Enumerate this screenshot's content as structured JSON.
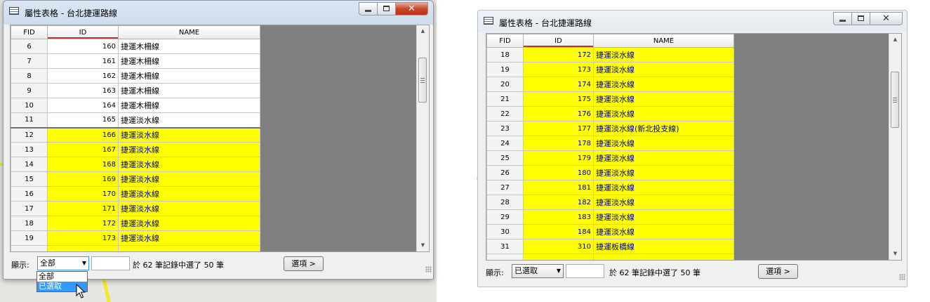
{
  "left_window": {
    "title": "屬性表格 - 台北捷運路線",
    "columns": [
      "FID",
      "ID",
      "NAME"
    ],
    "rows": [
      {
        "fid": "6",
        "id": "160",
        "name": "捷運木柵線",
        "selected": false
      },
      {
        "fid": "7",
        "id": "161",
        "name": "捷運木柵線",
        "selected": false
      },
      {
        "fid": "8",
        "id": "162",
        "name": "捷運木柵線",
        "selected": false
      },
      {
        "fid": "9",
        "id": "163",
        "name": "捷運木柵線",
        "selected": false
      },
      {
        "fid": "10",
        "id": "164",
        "name": "捷運木柵線",
        "selected": false
      },
      {
        "fid": "11",
        "id": "165",
        "name": "捷運淡水線",
        "selected": false
      },
      {
        "fid": "12",
        "id": "166",
        "name": "捷運淡水線",
        "selected": true
      },
      {
        "fid": "13",
        "id": "167",
        "name": "捷運淡水線",
        "selected": true
      },
      {
        "fid": "14",
        "id": "168",
        "name": "捷運淡水線",
        "selected": true
      },
      {
        "fid": "15",
        "id": "169",
        "name": "捷運淡水線",
        "selected": true
      },
      {
        "fid": "16",
        "id": "170",
        "name": "捷運淡水線",
        "selected": true
      },
      {
        "fid": "17",
        "id": "171",
        "name": "捷運淡水線",
        "selected": true
      },
      {
        "fid": "18",
        "id": "172",
        "name": "捷運淡水線",
        "selected": true
      },
      {
        "fid": "19",
        "id": "173",
        "name": "捷運淡水線",
        "selected": true
      }
    ],
    "footer": {
      "show_label": "顯示:",
      "show_value": "全部",
      "record_text": "於 62 筆記錄中選了 50 筆",
      "options_button": "選項 >"
    },
    "dropdown_options": [
      "全部",
      "已選取"
    ],
    "highlighted_option": "已選取"
  },
  "right_window": {
    "title": "屬性表格 - 台北捷運路線",
    "columns": [
      "FID",
      "ID",
      "NAME"
    ],
    "rows": [
      {
        "fid": "18",
        "id": "172",
        "name": "捷運淡水線",
        "selected": true
      },
      {
        "fid": "19",
        "id": "173",
        "name": "捷運淡水線",
        "selected": true
      },
      {
        "fid": "20",
        "id": "174",
        "name": "捷運淡水線",
        "selected": true
      },
      {
        "fid": "21",
        "id": "175",
        "name": "捷運淡水線",
        "selected": true
      },
      {
        "fid": "22",
        "id": "176",
        "name": "捷運淡水線",
        "selected": true
      },
      {
        "fid": "23",
        "id": "177",
        "name": "捷運淡水線(新北投支線)",
        "selected": true
      },
      {
        "fid": "24",
        "id": "178",
        "name": "捷運淡水線",
        "selected": true
      },
      {
        "fid": "25",
        "id": "179",
        "name": "捷運淡水線",
        "selected": true
      },
      {
        "fid": "26",
        "id": "180",
        "name": "捷運淡水線",
        "selected": true
      },
      {
        "fid": "27",
        "id": "181",
        "name": "捷運淡水線",
        "selected": true
      },
      {
        "fid": "28",
        "id": "182",
        "name": "捷運淡水線",
        "selected": true
      },
      {
        "fid": "29",
        "id": "183",
        "name": "捷運淡水線",
        "selected": true
      },
      {
        "fid": "30",
        "id": "184",
        "name": "捷運淡水線",
        "selected": true
      },
      {
        "fid": "31",
        "id": "310",
        "name": "捷運板橋線",
        "selected": true
      }
    ],
    "footer": {
      "show_label": "顯示:",
      "show_value": "已選取",
      "record_text": "於 62 筆記錄中選了 50 筆",
      "options_button": "選項 >"
    }
  },
  "colors": {
    "selected_row": "#ffff00",
    "selected_text": "#000080",
    "grid_background": "#808080",
    "highlight": "#3399ff"
  },
  "icons": [
    "table-icon",
    "minimize-icon",
    "maximize-icon",
    "close-icon",
    "scroll-up-arrow-icon",
    "scroll-down-arrow-icon",
    "dropdown-arrow-icon",
    "resize-grip-icon",
    "mouse-cursor-icon"
  ]
}
